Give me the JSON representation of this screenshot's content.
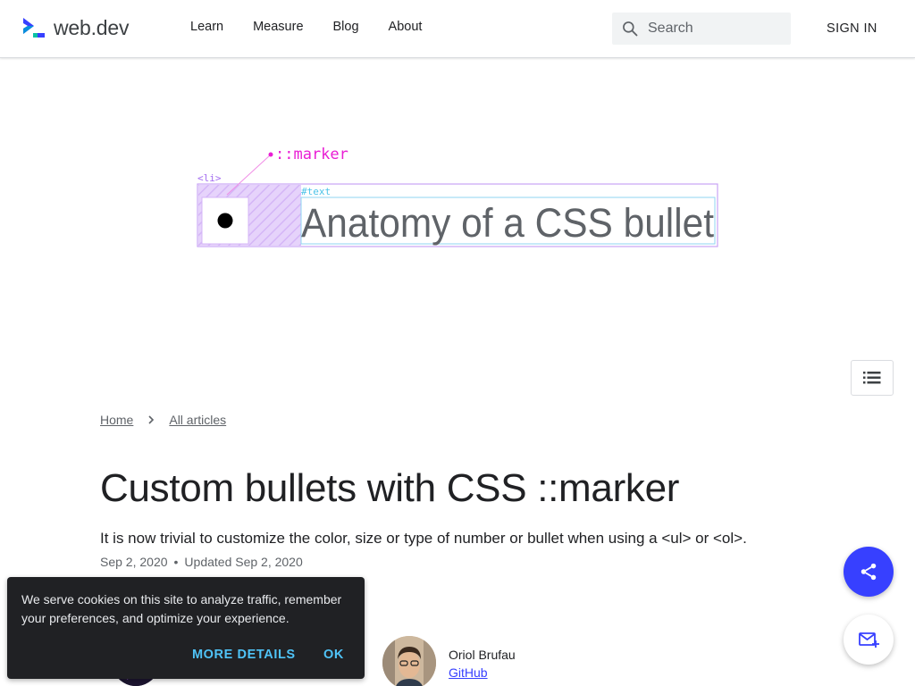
{
  "header": {
    "logo_text": "web.dev",
    "nav": [
      "Learn",
      "Measure",
      "Blog",
      "About"
    ],
    "search_placeholder": "Search",
    "signin_label": "SIGN IN"
  },
  "hero": {
    "marker_label": "::marker",
    "li_label": "<li>",
    "text_label": "#text",
    "headline": "Anatomy of a CSS bullet"
  },
  "breadcrumb": {
    "home": "Home",
    "all_articles": "All articles"
  },
  "article": {
    "title": "Custom bullets with CSS ::marker",
    "subtitle": "It is now trivial to customize the color, size or type of number or bullet when using a <ul> or <ol>.",
    "published": "Sep 2, 2020",
    "separator": "•",
    "updated": "Updated Sep 2, 2020"
  },
  "author": {
    "name": "Oriol Brufau",
    "link": "GitHub"
  },
  "cookie": {
    "text": "We serve cookies on this site to analyze traffic, remember your preferences, and optimize your experience.",
    "more_details": "MORE DETAILS",
    "ok": "OK"
  },
  "icons": {
    "search": "search-icon",
    "breadcrumb_separator": "chevron-right-icon",
    "toc": "list-icon",
    "share": "share-icon",
    "subscribe": "mail-add-icon"
  },
  "colors": {
    "brand": "#3740ff",
    "marker_magenta": "#e91ed4",
    "li_purple": "#a36cf0",
    "text_cyan": "#4dc3e8",
    "cookie_action": "#4fc3f7"
  }
}
